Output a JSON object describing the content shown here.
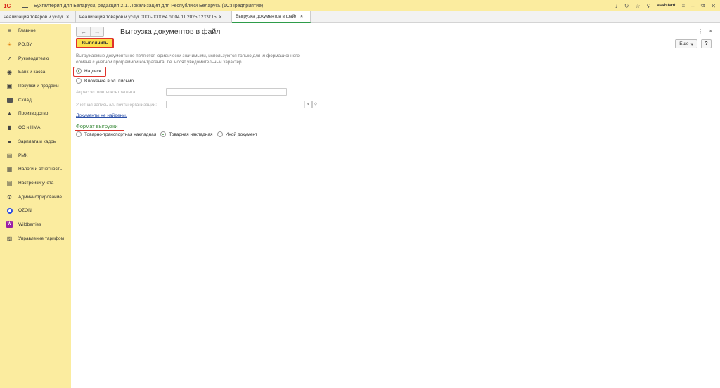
{
  "titlebar": {
    "logo": "1С",
    "app_title": "Бухгалтерия для Беларуси, редакция 2.1. Локализация для Республики Беларусь   (1С:Предприятие)",
    "user": "assistant"
  },
  "tabs": [
    {
      "label": "Реализация товаров и услуг",
      "close": "×"
    },
    {
      "label": "Реализация товаров и услуг 0000-000064 от 04.11.2025 12:09:15",
      "close": "×"
    },
    {
      "label": "Выгрузка документов в файл",
      "close": "×"
    }
  ],
  "sidebar": {
    "items": [
      {
        "label": "Главное"
      },
      {
        "label": "PO.BY"
      },
      {
        "label": "Руководителю"
      },
      {
        "label": "Банк и касса"
      },
      {
        "label": "Покупки и продажи"
      },
      {
        "label": "Склад"
      },
      {
        "label": "Производство"
      },
      {
        "label": "ОС и НМА"
      },
      {
        "label": "Зарплата и кадры"
      },
      {
        "label": "РМК"
      },
      {
        "label": "Налоги и отчетность"
      },
      {
        "label": "Настройки учета"
      },
      {
        "label": "Администрирование"
      },
      {
        "label": "OZON"
      },
      {
        "label": "Wildberries"
      },
      {
        "label": "Управление тарифом"
      }
    ]
  },
  "form": {
    "title": "Выгрузка документов в файл",
    "execute_label": "Выполнить",
    "more_label": "Еще",
    "help_label": "?",
    "notice": "Выгружаемые документы не являются юридически значимыми, используются только для информационного обмена с учетной программой контрагента, т.е. носят уведомительный характер.",
    "destination": {
      "disk_label": "На диск",
      "mail_label": "Вложение в эл. письмо"
    },
    "email_address_label": "Адрес эл. почты контрагента:",
    "email_address_value": "",
    "email_account_label": "Учетная запись эл. почты организации:",
    "email_account_value": "",
    "docs_link": "Документы не найдены.",
    "format_title": "Формат выгрузки",
    "formats": [
      {
        "label": "Товарно-транспортная накладная",
        "selected": false
      },
      {
        "label": "Товарная накладная",
        "selected": true
      },
      {
        "label": "Иной документ",
        "selected": false
      }
    ]
  }
}
